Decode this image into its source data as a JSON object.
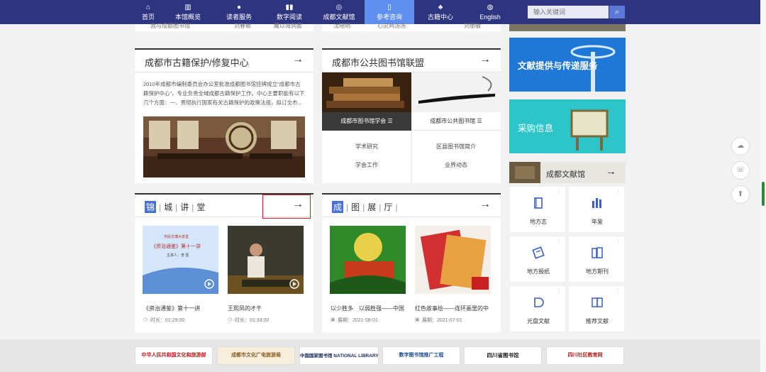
{
  "nav": {
    "items": [
      {
        "label": "首页",
        "icon": "home-icon"
      },
      {
        "label": "本馆概览",
        "icon": "building-icon"
      },
      {
        "label": "读者服务",
        "icon": "reader-icon"
      },
      {
        "label": "数字阅读",
        "icon": "books-icon"
      },
      {
        "label": "成都文献馆",
        "icon": "archive-icon"
      },
      {
        "label": "参考咨询",
        "icon": "document-icon"
      },
      {
        "label": "古籍中心",
        "icon": "ancient-book-icon"
      },
      {
        "label": "English",
        "icon": "globe-icon"
      }
    ],
    "active_index": 5,
    "search_placeholder": "输入关键词",
    "accent": "#2d3580",
    "active_color": "#5f8ff0"
  },
  "top_cut": {
    "left_text": "我与成都图书馆",
    "items": [
      "刘春颖",
      "藏以海洞雾",
      "沈晓明",
      "心灵鸡汤汤",
      "刘丽敏"
    ]
  },
  "ancient_panel": {
    "title": "成都市古籍保护/修复中心",
    "text": "2010年成都市编制委员会办公室批准成都图书馆挂牌成立“成都市古籍保护中心”，专业负责全域成都古籍保护工作。中心主要职能有以下几个方面：一、贯彻执行国家有关古籍保护的政策法规，拟订全市..."
  },
  "alliance_panel": {
    "title": "成都市公共图书馆联盟",
    "tab1": "成都市图书馆学会 ☰",
    "tab2": "成都市公共图书馆 ☰",
    "links_left": [
      "学术研究",
      "学会工作"
    ],
    "links_right": [
      "区县图书馆简介",
      "业界动态"
    ]
  },
  "lecture_panel": {
    "title_chars": [
      "锦",
      "城",
      "讲",
      "堂"
    ],
    "cards": [
      {
        "caption": "《资治通鉴》第十一讲",
        "meta": "时长：01:29:00",
        "slide_title": "《资治通鉴》第十一讲",
        "slide_sub": "主讲人：李 蔷",
        "slide_top": "市民文博大讲堂"
      },
      {
        "caption": "王熙凤的才干",
        "meta": "时长：01:33:00",
        "slide_title": "",
        "slide_sub": "",
        "slide_top": ""
      }
    ]
  },
  "exhibit_panel": {
    "title_chars": [
      "成",
      "图",
      "展",
      "厅"
    ],
    "cards": [
      {
        "caption": "以少胜多　以弱胜强——中国",
        "meta": "展期：2021-08-01"
      },
      {
        "caption": "红色故事绘——连环画里的中",
        "meta": "展期：2021-07-01"
      }
    ]
  },
  "right_col": {
    "banner1": "文献提供与传递服务",
    "banner2": "采购信息",
    "wenxian_title": "成都文献馆",
    "grid": [
      {
        "label": "地方志",
        "icon": "book-icon"
      },
      {
        "label": "年鉴",
        "icon": "bar-chart-icon"
      },
      {
        "label": "地方报纸",
        "icon": "newspaper-icon"
      },
      {
        "label": "地方期刊",
        "icon": "magazine-icon"
      },
      {
        "label": "光盘文献",
        "icon": "disc-icon"
      },
      {
        "label": "推荐文献",
        "icon": "open-book-icon"
      }
    ]
  },
  "footer": {
    "logos": [
      "中华人民共和国文化和旅游部",
      "成都市文化广电旅游局",
      "中国国家图书馆 NATIONAL LIBRARY OF CHINA",
      "数字图书馆推广工程",
      "四川省图书馆",
      "四川社区教育网"
    ]
  }
}
